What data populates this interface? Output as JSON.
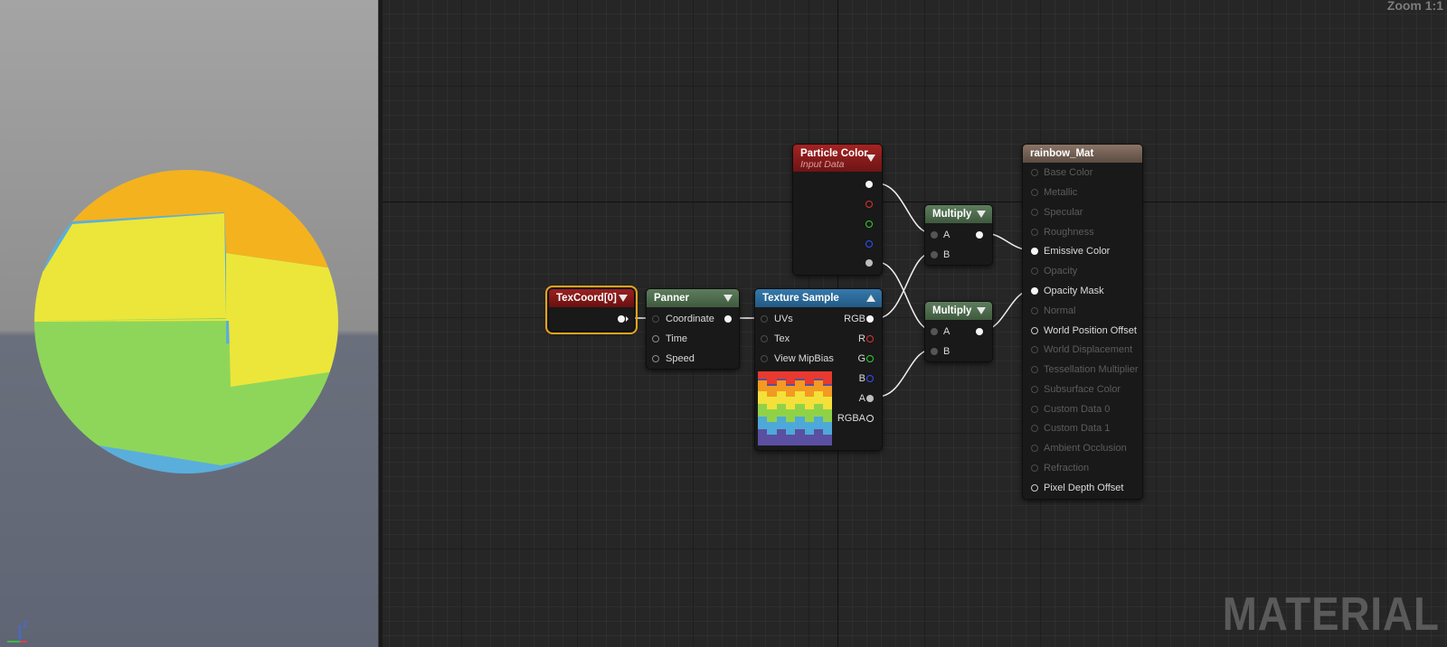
{
  "graph": {
    "zoom_label": "Zoom 1:1",
    "watermark": "MATERIAL"
  },
  "nodes": {
    "texcoord": {
      "title": "TexCoord[0]"
    },
    "panner": {
      "title": "Panner",
      "inputs": [
        "Coordinate",
        "Time",
        "Speed"
      ]
    },
    "texture_sample": {
      "title": "Texture Sample",
      "inputs": [
        "UVs",
        "Tex",
        "View MipBias"
      ],
      "outputs": [
        "RGB",
        "R",
        "G",
        "B",
        "A",
        "RGBA"
      ]
    },
    "particle_color": {
      "title": "Particle Color",
      "subtitle": "Input Data"
    },
    "multiply_1": {
      "title": "Multiply",
      "inputs": [
        "A",
        "B"
      ]
    },
    "multiply_2": {
      "title": "Multiply",
      "inputs": [
        "A",
        "B"
      ]
    },
    "material_result": {
      "title": "rainbow_Mat",
      "inputs": [
        "Base Color",
        "Metallic",
        "Specular",
        "Roughness",
        "Emissive Color",
        "Opacity",
        "Opacity Mask",
        "Normal",
        "World Position Offset",
        "World Displacement",
        "Tessellation Multiplier",
        "Subsurface Color",
        "Custom Data 0",
        "Custom Data 1",
        "Ambient Occlusion",
        "Refraction",
        "Pixel Depth Offset"
      ]
    }
  },
  "colors": {
    "texcoord_header": "#8a1a1a",
    "panner_header": "#4f6e4f",
    "texture_header": "#2d6b9c",
    "particle_header": "#8e1c1c",
    "multiply_header": "#4f6e4f",
    "result_header": "#6e5a4e",
    "selection_outline": "#e9a31a"
  },
  "viewport": {
    "axis_z": "Z"
  }
}
